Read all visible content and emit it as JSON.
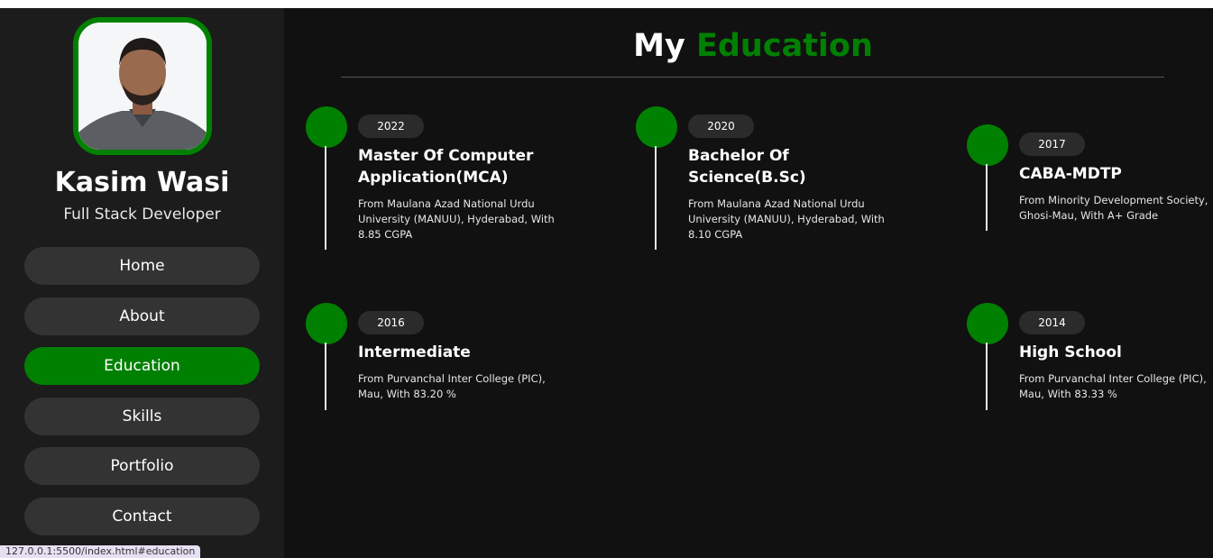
{
  "profile": {
    "name": "Kasim Wasi",
    "role": "Full Stack Developer"
  },
  "nav": [
    {
      "label": "Home",
      "active": false
    },
    {
      "label": "About",
      "active": false
    },
    {
      "label": "Education",
      "active": true
    },
    {
      "label": "Skills",
      "active": false
    },
    {
      "label": "Portfolio",
      "active": false
    },
    {
      "label": "Contact",
      "active": false
    }
  ],
  "section": {
    "title_prefix": "My",
    "title_accent": "Education"
  },
  "education": [
    {
      "year": "2022",
      "degree": "Master Of Computer Application(MCA)",
      "description": "From Maulana Azad National Urdu University (MANUU), Hyderabad, With 8.85 CGPA"
    },
    {
      "year": "2020",
      "degree": "Bachelor Of Science(B.Sc)",
      "description": "From Maulana Azad National Urdu University (MANUU), Hyderabad, With 8.10 CGPA"
    },
    {
      "year": "2017",
      "degree": "CABA-MDTP",
      "description": "From Minority Development Society, Ghosi-Mau, With A+ Grade"
    },
    {
      "year": "2016",
      "degree": "Intermediate",
      "description": "From Purvanchal Inter College (PIC), Mau, With 83.20 %"
    },
    {
      "year": "2014",
      "degree": "High School",
      "description": "From Purvanchal Inter College (PIC), Mau, With 83.33 %"
    }
  ],
  "status_bar": {
    "url": "127.0.0.1:5500/index.html#education"
  },
  "colors": {
    "accent": "#008000",
    "background": "#111111",
    "sidebar": "#1c1c1c",
    "pill": "#333333"
  }
}
